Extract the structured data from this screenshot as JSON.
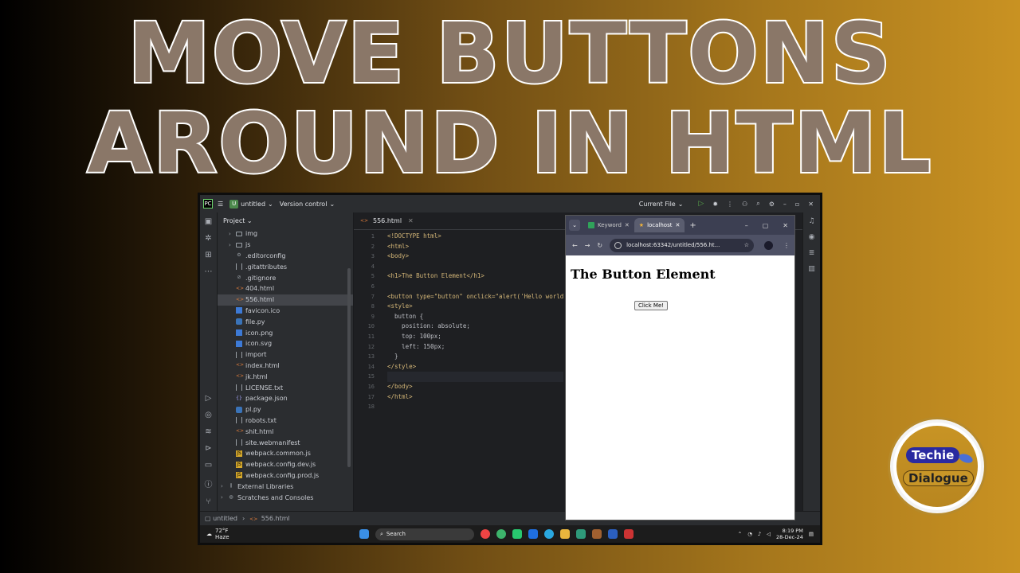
{
  "headline": {
    "line1": "MOVE BUTTONS",
    "line2": "AROUND IN HTML"
  },
  "ide": {
    "project_name": "untitled",
    "vcs": "Version control",
    "run_config": "Current File",
    "project_panel_title": "Project",
    "tree": [
      {
        "name": "img",
        "icon": "folder-icon",
        "arrow": true
      },
      {
        "name": "js",
        "icon": "folder-icon",
        "arrow": true
      },
      {
        "name": ".editorconfig",
        "icon": "gear-icon"
      },
      {
        "name": ".gitattributes",
        "icon": "text-file-icon"
      },
      {
        "name": ".gitignore",
        "icon": "ignore-icon"
      },
      {
        "name": "404.html",
        "icon": "html-file-icon"
      },
      {
        "name": "556.html",
        "icon": "html-file-icon",
        "selected": true
      },
      {
        "name": "favicon.ico",
        "icon": "image-file-icon"
      },
      {
        "name": "file.py",
        "icon": "python-file-icon"
      },
      {
        "name": "icon.png",
        "icon": "image-file-icon"
      },
      {
        "name": "icon.svg",
        "icon": "image-file-icon"
      },
      {
        "name": "import",
        "icon": "text-file-icon"
      },
      {
        "name": "index.html",
        "icon": "html-file-icon"
      },
      {
        "name": "jk.html",
        "icon": "html-file-icon"
      },
      {
        "name": "LICENSE.txt",
        "icon": "text-file-icon"
      },
      {
        "name": "package.json",
        "icon": "json-file-icon"
      },
      {
        "name": "pl.py",
        "icon": "python-file-icon"
      },
      {
        "name": "robots.txt",
        "icon": "text-file-icon"
      },
      {
        "name": "shit.html",
        "icon": "html-file-icon"
      },
      {
        "name": "site.webmanifest",
        "icon": "text-file-icon"
      },
      {
        "name": "webpack.common.js",
        "icon": "js-file-icon"
      },
      {
        "name": "webpack.config.dev.js",
        "icon": "js-file-icon"
      },
      {
        "name": "webpack.config.prod.js",
        "icon": "js-file-icon"
      },
      {
        "name": "External Libraries",
        "icon": "library-icon",
        "arrow": true,
        "outdent": true
      },
      {
        "name": "Scratches and Consoles",
        "icon": "scratch-icon",
        "arrow": true,
        "outdent": true
      }
    ],
    "editor_tab": "556.html",
    "line_numbers": [
      "1",
      "2",
      "3",
      "4",
      "5",
      "6",
      "7",
      "8",
      "9",
      "10",
      "11",
      "12",
      "13",
      "14",
      "15",
      "16",
      "17",
      "18"
    ],
    "code_lines": [
      "<!DOCTYPE html>",
      "<html>",
      "<body>",
      "",
      "<h1>The Button Element</h1>",
      "",
      "<button type=\"button\" onclick=\"alert('Hello world",
      "<style>",
      "  button {",
      "    position: absolute;",
      "    top: 100px;",
      "    left: 150px;",
      "  }",
      "</style>",
      "",
      "</body>",
      "</html>",
      ""
    ],
    "breadcrumb": {
      "project": "untitled",
      "file": "556.html"
    },
    "taskbar": {
      "temperature": "72°F",
      "weather": "Haze",
      "search_placeholder": "Search",
      "time": "8:19 PM",
      "date": "28-Dec-24"
    }
  },
  "browser": {
    "tab1": "Keyword",
    "tab2": "localhost",
    "url": "localhost:63342/untitled/556.ht...",
    "page_heading": "The Button Element",
    "button_label": "Click Me!"
  },
  "badge": {
    "line1": "Techie",
    "line2": "Dialogue"
  }
}
